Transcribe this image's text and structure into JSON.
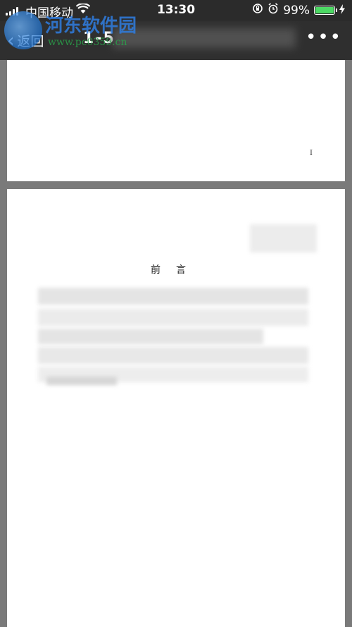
{
  "status_bar": {
    "carrier": "中国移动",
    "time": "13:30",
    "battery": "99%",
    "battery_level": 0.99,
    "battery_color": "#4cd964"
  },
  "nav": {
    "back_label": "返回",
    "page_indicator": "1-5",
    "more_label": "•••"
  },
  "watermark": {
    "title": "河东软件园",
    "url": "www.pc0359.cn"
  },
  "document": {
    "page1_number": "I",
    "page2_heading": "前言"
  },
  "icons": [
    "signal-icon",
    "wifi-icon",
    "orientation-lock-icon",
    "alarm-icon",
    "battery-icon",
    "charging-icon",
    "back-chevron-icon",
    "more-icon"
  ]
}
